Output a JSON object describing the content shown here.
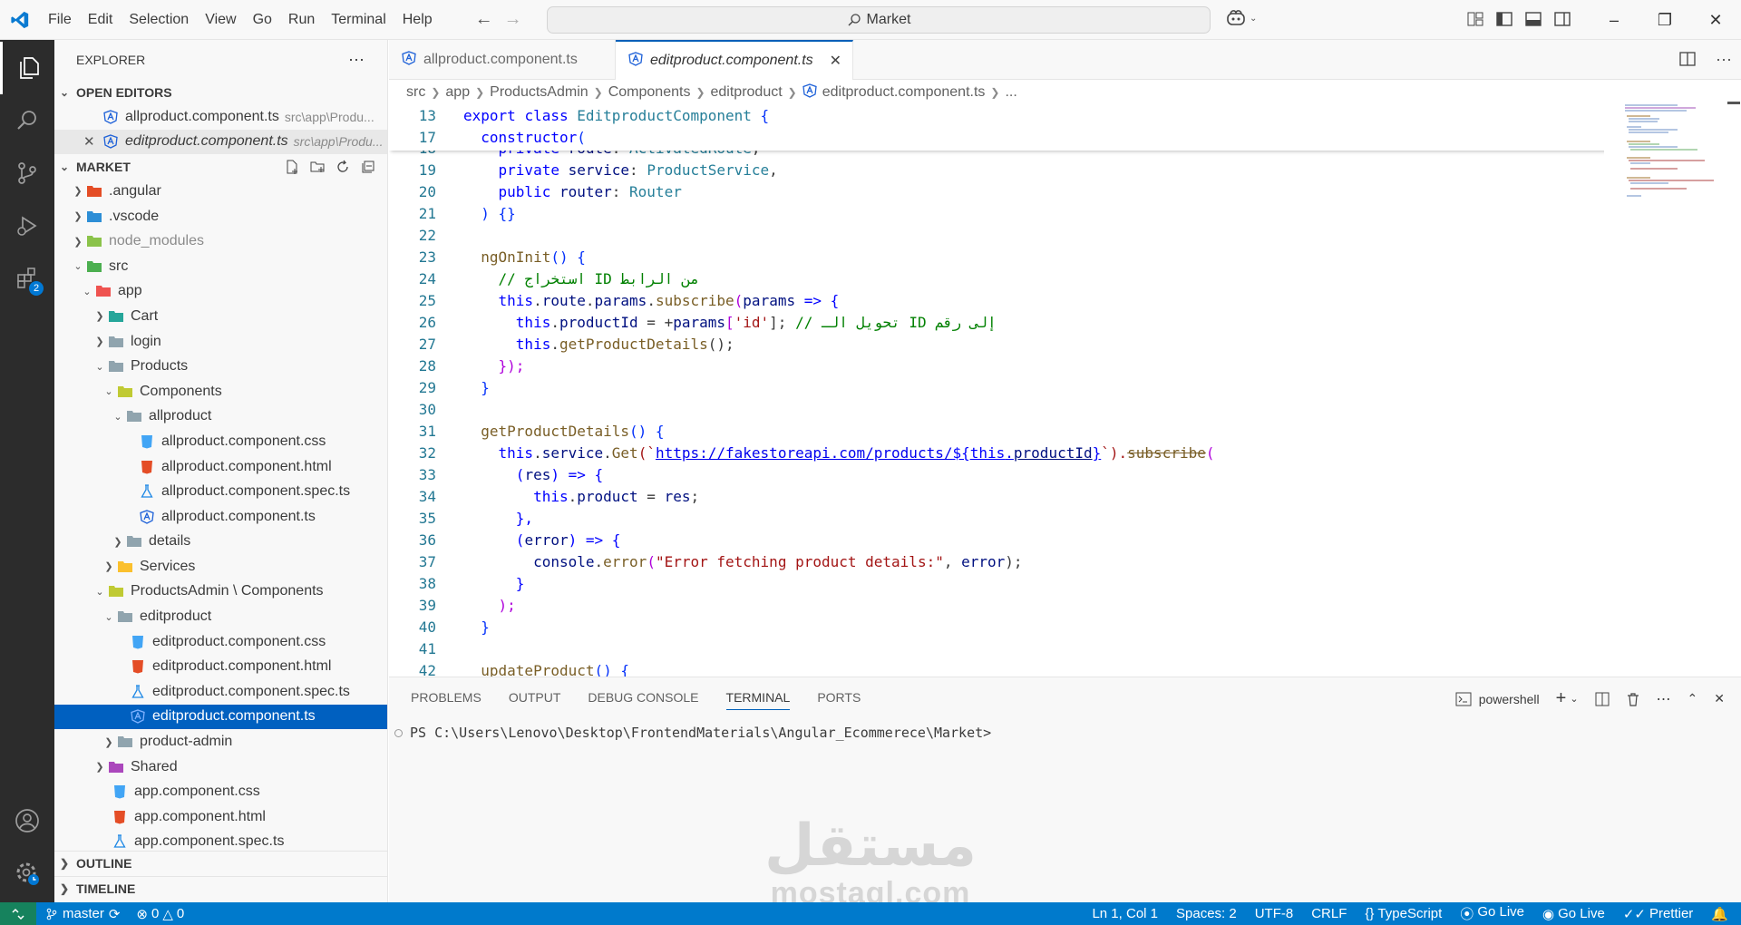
{
  "menu": [
    "File",
    "Edit",
    "Selection",
    "View",
    "Go",
    "Run",
    "Terminal",
    "Help"
  ],
  "search": "Market",
  "explorer": {
    "title": "EXPLORER",
    "open_editors_label": "OPEN EDITORS",
    "open_editors": [
      {
        "name": "allproduct.component.ts",
        "path": "src\\app\\Produ..."
      },
      {
        "name": "editproduct.component.ts",
        "path": "src\\app\\Produ..."
      }
    ],
    "workspace": "MARKET",
    "tree": [
      {
        "label": ".angular"
      },
      {
        "label": ".vscode"
      },
      {
        "label": "node_modules"
      },
      {
        "label": "src"
      },
      {
        "label": "app"
      },
      {
        "label": "Cart"
      },
      {
        "label": "login"
      },
      {
        "label": "Products"
      },
      {
        "label": "Components"
      },
      {
        "label": "allproduct"
      },
      {
        "label": "allproduct.component.css"
      },
      {
        "label": "allproduct.component.html"
      },
      {
        "label": "allproduct.component.spec.ts"
      },
      {
        "label": "allproduct.component.ts"
      },
      {
        "label": "details"
      },
      {
        "label": "Services"
      },
      {
        "label": "ProductsAdmin \\ Components"
      },
      {
        "label": "editproduct"
      },
      {
        "label": "editproduct.component.css"
      },
      {
        "label": "editproduct.component.html"
      },
      {
        "label": "editproduct.component.spec.ts"
      },
      {
        "label": "editproduct.component.ts"
      },
      {
        "label": "product-admin"
      },
      {
        "label": "Shared"
      },
      {
        "label": "app.component.css"
      },
      {
        "label": "app.component.html"
      },
      {
        "label": "app.component.spec.ts"
      }
    ],
    "outline": "OUTLINE",
    "timeline": "TIMELINE"
  },
  "activity": {
    "extensions_badge": "2"
  },
  "tabs": [
    {
      "label": "allproduct.component.ts"
    },
    {
      "label": "editproduct.component.ts"
    }
  ],
  "breadcrumb": [
    "src",
    "app",
    "ProductsAdmin",
    "Components",
    "editproduct",
    "editproduct.component.ts",
    "..."
  ],
  "code": {
    "line_numbers": [
      "13",
      "17",
      "18",
      "19",
      "20",
      "21",
      "22",
      "23",
      "24",
      "25",
      "26",
      "27",
      "28",
      "29",
      "30",
      "31",
      "32",
      "33",
      "34",
      "35",
      "36",
      "37",
      "38",
      "39",
      "40",
      "41",
      "42"
    ],
    "l13": [
      "export",
      "class",
      "EditproductComponent",
      "{"
    ],
    "l17": [
      "constructor",
      "("
    ],
    "l18": [
      "private",
      "route",
      ": ",
      "ActivatedRoute",
      ","
    ],
    "l19": [
      "private",
      "service",
      ": ",
      "ProductService",
      ","
    ],
    "l20": [
      "public",
      "router",
      ": ",
      "Router"
    ],
    "l21": ") {}",
    "l23": [
      "ngOnInit",
      "() {"
    ],
    "l24": "// استخراج ID من الرابط",
    "l25": [
      "this",
      ".",
      "route",
      ".",
      "params",
      ".",
      "subscribe",
      "(",
      "params",
      " => {"
    ],
    "l26": [
      "this",
      ".",
      "productId",
      " = +",
      "params",
      "[",
      "'id'",
      "]; ",
      "// تحويل الـ ID إلى رقم"
    ],
    "l27": [
      "this",
      ".",
      "getProductDetails",
      "();"
    ],
    "l28": "});",
    "l29": "}",
    "l31": [
      "getProductDetails",
      "() {"
    ],
    "l32": [
      "this",
      ".",
      "service",
      ".",
      "Get",
      "(`",
      "https://fakestoreapi.com/products/",
      "${",
      "this",
      ".",
      "productId",
      "}",
      "`).",
      "subscribe",
      "("
    ],
    "l33": [
      "(",
      "res",
      ") => {"
    ],
    "l34": [
      "this",
      ".",
      "product",
      " = ",
      "res",
      ";"
    ],
    "l35": "},",
    "l36": [
      "(",
      "error",
      ") => {"
    ],
    "l37": [
      "console",
      ".",
      "error",
      "(",
      "\"Error fetching product details:\"",
      ", ",
      "error",
      ");"
    ],
    "l38": "}",
    "l39": ");",
    "l40": "}",
    "l42": [
      "updateProduct",
      "() {"
    ]
  },
  "panel": {
    "tabs": [
      "PROBLEMS",
      "OUTPUT",
      "DEBUG CONSOLE",
      "TERMINAL",
      "PORTS"
    ],
    "shell": "powershell",
    "prompt": "PS C:\\Users\\Lenovo\\Desktop\\FrontendMaterials\\Angular_Ecommerece\\Market>"
  },
  "watermark": {
    "arabic": "مستقل",
    "latin": "mostaql.com"
  },
  "status": {
    "branch": "master",
    "errors": "0",
    "warnings": "0",
    "position": "Ln 1, Col 1",
    "spaces": "Spaces: 2",
    "encoding": "UTF-8",
    "eol": "CRLF",
    "language": "TypeScript",
    "golive1": "Go Live",
    "golive2": "Go Live",
    "prettier": "Prettier"
  },
  "colors": {
    "accent": "#007acc",
    "selection": "#0060c0",
    "angular": "#1e61d8"
  }
}
